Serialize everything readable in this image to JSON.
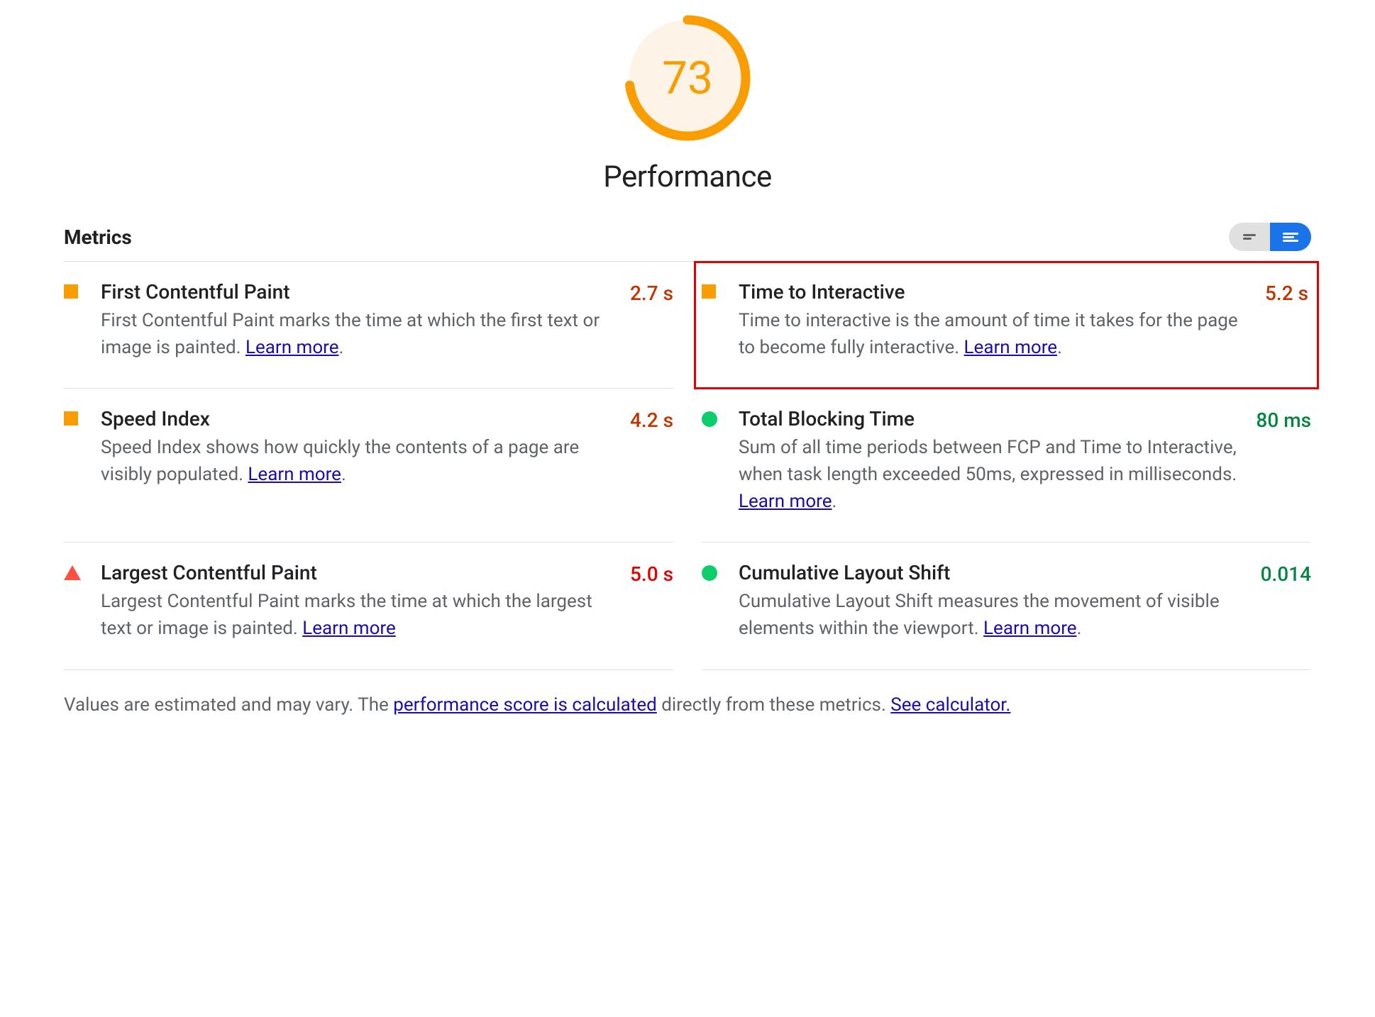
{
  "score": {
    "value": "73",
    "title": "Performance"
  },
  "metrics_header": {
    "title": "Metrics"
  },
  "metrics": [
    {
      "id": "fcp",
      "title": "First Contentful Paint",
      "desc": "First Contentful Paint marks the time at which the first text or image is painted. ",
      "learn_more": "Learn more",
      "after": ".",
      "value": "2.7 s",
      "status": "orange",
      "highlighted": false
    },
    {
      "id": "tti",
      "title": "Time to Interactive",
      "desc": "Time to interactive is the amount of time it takes for the page to become fully interactive. ",
      "learn_more": "Learn more",
      "after": ".",
      "value": "5.2 s",
      "status": "orange",
      "highlighted": true
    },
    {
      "id": "si",
      "title": "Speed Index",
      "desc": "Speed Index shows how quickly the contents of a page are visibly populated. ",
      "learn_more": "Learn more",
      "after": ".",
      "value": "4.2 s",
      "status": "orange",
      "highlighted": false
    },
    {
      "id": "tbt",
      "title": "Total Blocking Time",
      "desc": "Sum of all time periods between FCP and Time to Interactive, when task length exceeded 50ms, expressed in milliseconds. ",
      "learn_more": "Learn more",
      "after": ".",
      "value": "80 ms",
      "status": "green",
      "highlighted": false
    },
    {
      "id": "lcp",
      "title": "Largest Contentful Paint",
      "desc": "Largest Contentful Paint marks the time at which the largest text or image is painted. ",
      "learn_more": "Learn more",
      "after": "",
      "value": "5.0 s",
      "status": "red",
      "highlighted": false
    },
    {
      "id": "cls",
      "title": "Cumulative Layout Shift",
      "desc": "Cumulative Layout Shift measures the movement of visible elements within the viewport. ",
      "learn_more": "Learn more",
      "after": ".",
      "value": "0.014",
      "status": "green",
      "highlighted": false
    }
  ],
  "footnote": {
    "pre": "Values are estimated and may vary. The ",
    "link1": "performance score is calculated",
    "mid": " directly from these metrics. ",
    "link2": "See calculator."
  },
  "colors": {
    "orange": "#fa9d00",
    "red": "#ff4e42",
    "green": "#0cce6b"
  }
}
